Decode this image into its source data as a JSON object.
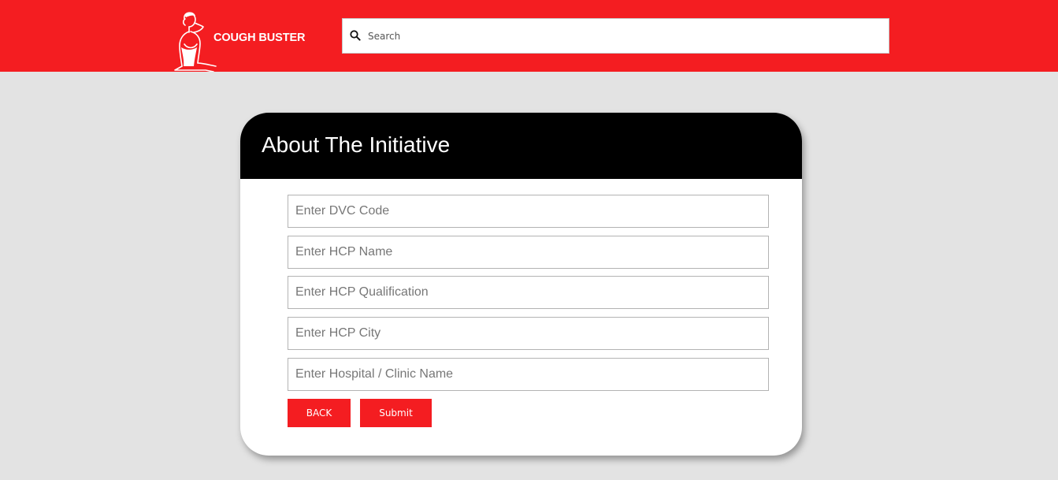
{
  "header": {
    "brand": "COUGH BUSTER",
    "search_placeholder": "Search",
    "search_icon": "search-icon",
    "logo_icon": "person-coughing-icon"
  },
  "card": {
    "title": "About The Initiative",
    "fields": [
      {
        "placeholder": "Enter DVC Code",
        "value": ""
      },
      {
        "placeholder": "Enter HCP Name",
        "value": ""
      },
      {
        "placeholder": "Enter HCP Qualification",
        "value": ""
      },
      {
        "placeholder": "Enter HCP City",
        "value": ""
      },
      {
        "placeholder": "Enter Hospital / Clinic Name",
        "value": ""
      }
    ],
    "back_label": "BACK",
    "submit_label": "Submit"
  },
  "colors": {
    "brand_red": "#f41d21",
    "page_background": "#e3e3e3",
    "card_header": "#000000"
  }
}
